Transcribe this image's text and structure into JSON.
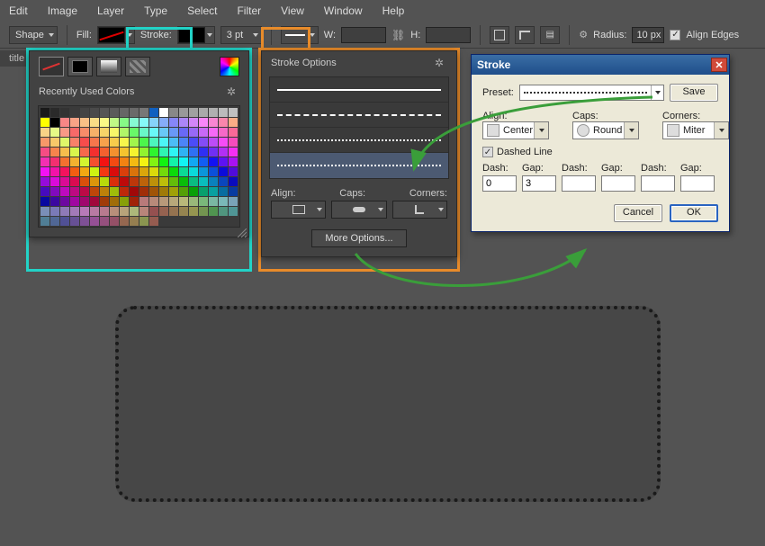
{
  "menu": [
    "Edit",
    "Image",
    "Layer",
    "Type",
    "Select",
    "Filter",
    "View",
    "Window",
    "Help"
  ],
  "optbar": {
    "shape": "Shape",
    "fill": "Fill:",
    "stroke": "Stroke:",
    "strokeWidth": "3 pt",
    "w": "W:",
    "h": "H:",
    "radiusLabel": "Radius:",
    "radiusVal": "10 px",
    "alignEdges": "Align Edges"
  },
  "doctab": "title",
  "picker": {
    "recentHeader": "Recently Used Colors"
  },
  "strokeopt": {
    "title": "Stroke Options",
    "align": "Align:",
    "caps": "Caps:",
    "corners": "Corners:",
    "more": "More Options..."
  },
  "windlg": {
    "title": "Stroke",
    "preset": "Preset:",
    "save": "Save",
    "align": "Align:",
    "alignVal": "Center",
    "caps": "Caps:",
    "capsVal": "Round",
    "corners": "Corners:",
    "cornersVal": "Miter",
    "dashedLine": "Dashed Line",
    "dash": "Dash:",
    "gap": "Gap:",
    "d1": "0",
    "g1": "3",
    "d2": "",
    "g2": "",
    "d3": "",
    "g3": "",
    "cancel": "Cancel",
    "ok": "OK"
  }
}
